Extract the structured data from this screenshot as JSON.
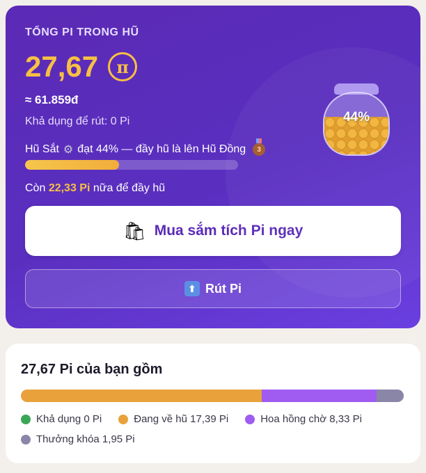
{
  "jar": {
    "eyebrow": "TỔNG PI TRONG HŨ",
    "total_amount": "27,67",
    "pi_symbol": "π",
    "fiat_value": "≈ 61.859đ",
    "withdrawable": "Khả dụng để rút: 0 Pi",
    "tier_prefix": "Hũ Sắt",
    "tier_text": "đạt 44% — đầy hũ là lên Hũ Đồng",
    "medal_number": "3",
    "progress_fraction": 0.44,
    "remaining_prefix": "Còn",
    "remaining_amount": "22,33 Pi",
    "remaining_suffix": "nữa để đầy hũ",
    "jar_percent": "44%",
    "shop_button": "Mua sắm tích Pi ngay",
    "withdraw_button": "Rút Pi",
    "gear_icon": "gear-icon",
    "bag_icon": "shopping-bag-icon",
    "upload_icon": "up-arrow-icon"
  },
  "breakdown": {
    "title": "27,67 Pi của bạn gồm",
    "segments": [
      {
        "label": "Khả dụng 0 Pi",
        "value": 0,
        "color": "#3aa757"
      },
      {
        "label": "Đang về hũ 17,39 Pi",
        "value": 17.39,
        "color": "#e9a23b"
      },
      {
        "label": "Hoa hồng chờ 8,33 Pi",
        "value": 8.33,
        "color": "#a05cf0"
      },
      {
        "label": "Thưởng khóa 1,95 Pi",
        "value": 1.95,
        "color": "#8a86a8"
      }
    ]
  },
  "colors": {
    "accent_gold": "#f7c044",
    "brand_purple": "#5a2ab8"
  }
}
